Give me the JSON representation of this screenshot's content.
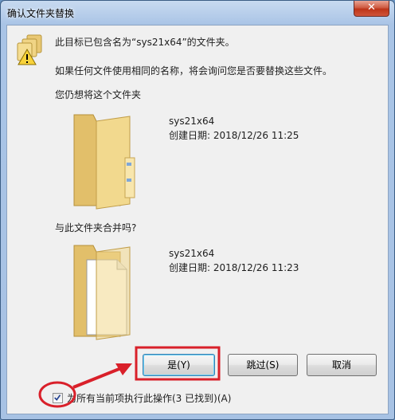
{
  "window": {
    "title": "确认文件夹替换",
    "close_glyph": "✕"
  },
  "messages": {
    "line1": "此目标已包含名为“sys21x64”的文件夹。",
    "line2": "如果任何文件使用相同的名称，将会询问您是否要替换这些文件。",
    "line3": "您仍想将这个文件夹",
    "line4": "与此文件夹合并吗?"
  },
  "source_folder": {
    "name": "sys21x64",
    "date": "创建日期: 2018/12/26 11:25"
  },
  "target_folder": {
    "name": "sys21x64",
    "date": "创建日期: 2018/12/26 11:23"
  },
  "buttons": {
    "yes": "是(Y)",
    "skip": "跳过(S)",
    "cancel": "取消"
  },
  "apply_all": {
    "checked": true,
    "label": "为所有当前项执行此操作(3 已找到)(A)"
  },
  "icons": [
    "warning-folders-icon",
    "folder-icon",
    "folder-with-document-icon",
    "checkmark-icon",
    "close-icon"
  ],
  "colors": {
    "annotation_red": "#d9202a",
    "title_bar": "#a9c4e6",
    "client_bg": "#f0f0f0"
  }
}
